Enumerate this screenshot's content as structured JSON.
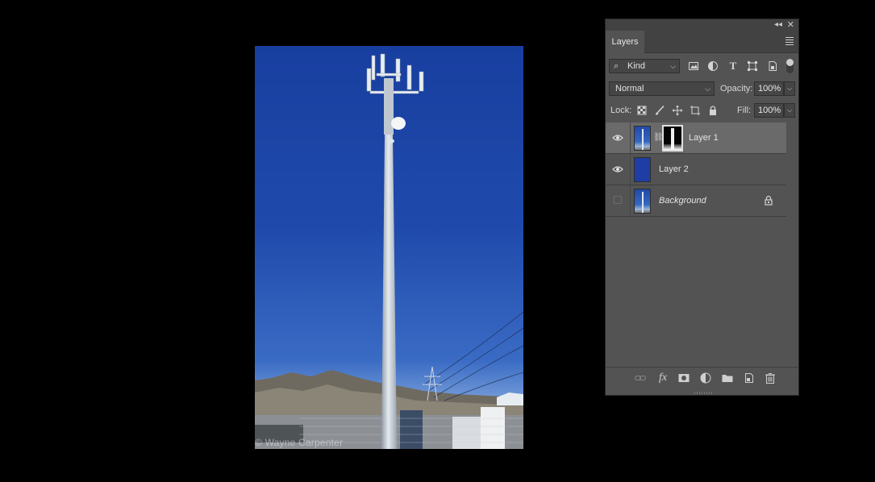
{
  "canvas": {
    "watermark": "© Wayne Carpenter",
    "colors": {
      "sky_top": "#183fa0",
      "sky_horizon": "#c9d8ea",
      "tower": "#c8d0d8"
    }
  },
  "layers_panel": {
    "tab_label": "Layers",
    "filter": {
      "kind_label": "Kind",
      "icons": [
        "image-filter-icon",
        "adjustment-filter-icon",
        "type-filter-icon",
        "shape-filter-icon",
        "smart-object-filter-icon",
        "filter-toggle"
      ]
    },
    "blend_mode": "Normal",
    "opacity_label": "Opacity:",
    "opacity_value": "100%",
    "lock_label": "Lock:",
    "lock_icons": [
      "lock-transparent-pixels-icon",
      "lock-image-pixels-icon",
      "lock-position-icon",
      "lock-artboard-icon",
      "lock-all-icon"
    ],
    "fill_label": "Fill:",
    "fill_value": "100%",
    "layers": [
      {
        "name": "Layer 1",
        "visible": true,
        "selected": true,
        "has_mask": true,
        "thumbnail": "photo"
      },
      {
        "name": "Layer 2",
        "visible": true,
        "selected": false,
        "has_mask": false,
        "thumbnail": "solid-blue"
      },
      {
        "name": "Background",
        "visible": false,
        "selected": false,
        "locked": true,
        "thumbnail": "photo"
      }
    ],
    "footer_icons": [
      "link-layers-icon",
      "fx-icon",
      "add-mask-icon",
      "adjustment-layer-icon",
      "new-group-icon",
      "new-layer-icon",
      "delete-layer-icon"
    ],
    "footer_fx_label": "fx"
  }
}
